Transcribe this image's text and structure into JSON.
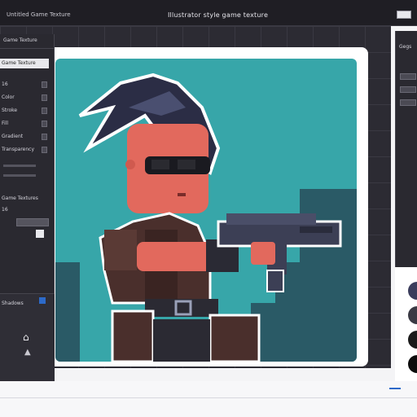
{
  "window": {
    "tab_label": "Untitled Game Texture",
    "title": "Illustrator style game texture"
  },
  "left_panel": {
    "header": "Game Texture",
    "preset": "Game Texture",
    "rows": [
      {
        "label": "16"
      },
      {
        "label": "Color"
      },
      {
        "label": "Stroke"
      },
      {
        "label": "Fill"
      },
      {
        "label": "Gradient"
      },
      {
        "label": "Transparency"
      }
    ],
    "section_label": "Game Textures",
    "field_label": "16",
    "sub_header": "Shadows"
  },
  "right_panel": {
    "label": "Gegs"
  },
  "colors": {
    "canvas_bg": "#37a6a9",
    "workspace": "#2c2b33",
    "panel": "#2a2930",
    "accent": "#2d6ac9",
    "palette": [
      "#3b3d5c",
      "#3a3a44",
      "#1a1a1a",
      "#0c0c0c"
    ]
  }
}
